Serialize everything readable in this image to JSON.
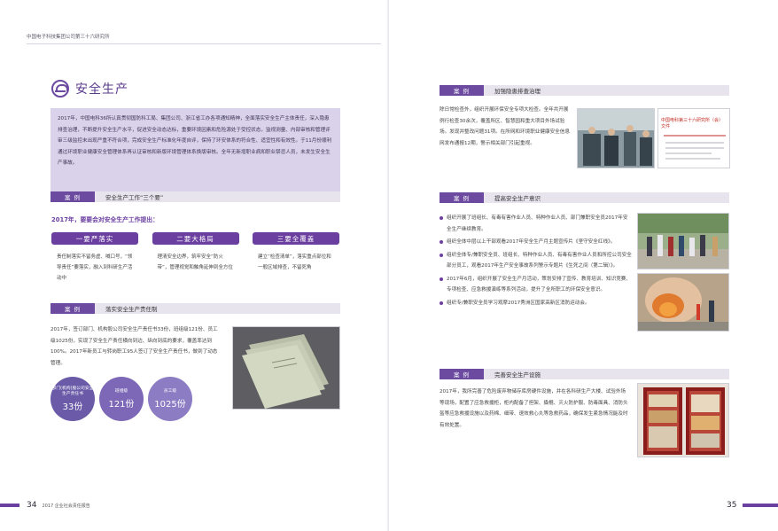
{
  "header": {
    "org": "中国电子科技集团公司第三十六研究所"
  },
  "left": {
    "section_title": "安全生产",
    "intro": "2017年，中国电科36所认真贯彻国防科工局、集团公司、浙江省工办各项通知精神，全面落实安全生产主体责任，深入隐患排查治理，不断提升安全生产水平，促进安全动态达标，重要环境因素和危险源处于受控状态，监视测量、内部审核和管理评审三级监控未出现严重不符合项，完成安全生产标准化年度自评，保持了环安体系的符合性、适宜性和有效性。于11月份顺利通过环境职业健康安全管理体系再认证审核和新版环境管理体系换版审核。全年无新增职业病和职业禁忌人员，未发生安全生产事故。",
    "case1": {
      "tag": "案 例",
      "title": "安全生产工作“三个要”"
    },
    "sub_heading": "2017年，要要会对安全生产工作提出：",
    "three": [
      {
        "label": "一要严落实",
        "desc": "责任制落实不留务虚、喊口号，“领导责任”要落实，融入到科研生产活动中"
      },
      {
        "label": "二要大格局",
        "desc": "理清安全边界，筑牢安全“防火带”，管理视觉和触角延伸到全方位"
      },
      {
        "label": "三要全覆盖",
        "desc": "建立“检查清单”，落实重点部位和一般区域排查，不留死角"
      }
    ],
    "case2": {
      "tag": "案 例",
      "title": "落实安全生产责任制"
    },
    "case2_text": "2017年，签订部门、机构股公司安全生产责任书33份，班组级121份、员工级1025份，实现了安全生产责任横向到边、纵向到底的要求，覆盖率达到100%。2017年新员工与转岗职工95人签订了安全生产责任书，做到了动态管理。",
    "circles": [
      {
        "label": "部门(机构)股公司安全生产责任书",
        "value": "33份"
      },
      {
        "label": "班组级",
        "value": "121份"
      },
      {
        "label": "员工级",
        "value": "1025份"
      }
    ],
    "footer": {
      "page": "34",
      "text": "2017 企业社会责任报告"
    }
  },
  "right": {
    "case3": {
      "tag": "案 例",
      "title": "加强隐患排查治理"
    },
    "case3_text": "除日常检查外，组织开展环保安全专项大检查。全年共开展例行检查30余次，覆盖所区、智慧园和重大项目外场试验场。发现并整改问题31项。在所网和环境职业健康安全信息网发布通报12期，警示相关部门引起重视。",
    "case3_banner": "中国电科第三十六研究所（会）文件",
    "case4": {
      "tag": "案 例",
      "title": "提高安全生产意识"
    },
    "case4_items": [
      "组织开展了班组长、有毒有害作业人员、特种作业人员、部门兼职安全员2017年安全生产继续教育。",
      "组织全体中层以上干部观看2017年安全生产月主题宣传片《坚守安全红线》。",
      "组织全体专/兼职安全员、班组长、特种作业人员、有毒有害作业人员和所控公司安全部分员工，观看2017年生产安全事故系列警示专题片《生死之间（第二辑）》。",
      "2017年6月，组织开展了安全生产月活动，策划安排了宣传、教育培训、知识竞赛、专项检查、应急救援演练等系列活动，提升了全所职工的环保安全意识。",
      "组织专/兼职安全员学习观摩2017秀洲区国家高新区消防运动会。"
    ],
    "case5": {
      "tag": "案 例",
      "title": "完善安全生产设施"
    },
    "case5_text": "2017年，我所完善了危险废弃物储存库房硬件设施，并在各科研生产大楼、试验外场等现场，配置了应急救援柜，柜内配备了担架、撬棍、灭火防护服、防毒面具、消防头盔等应急救援设施以及药棉、细带、速效救心丸等急救药品，确保发生紧急情况能及时有效处置。",
    "footer": {
      "page": "35"
    }
  },
  "colors": {
    "accent": "#6b3fa0",
    "light": "#d9d2ea"
  }
}
